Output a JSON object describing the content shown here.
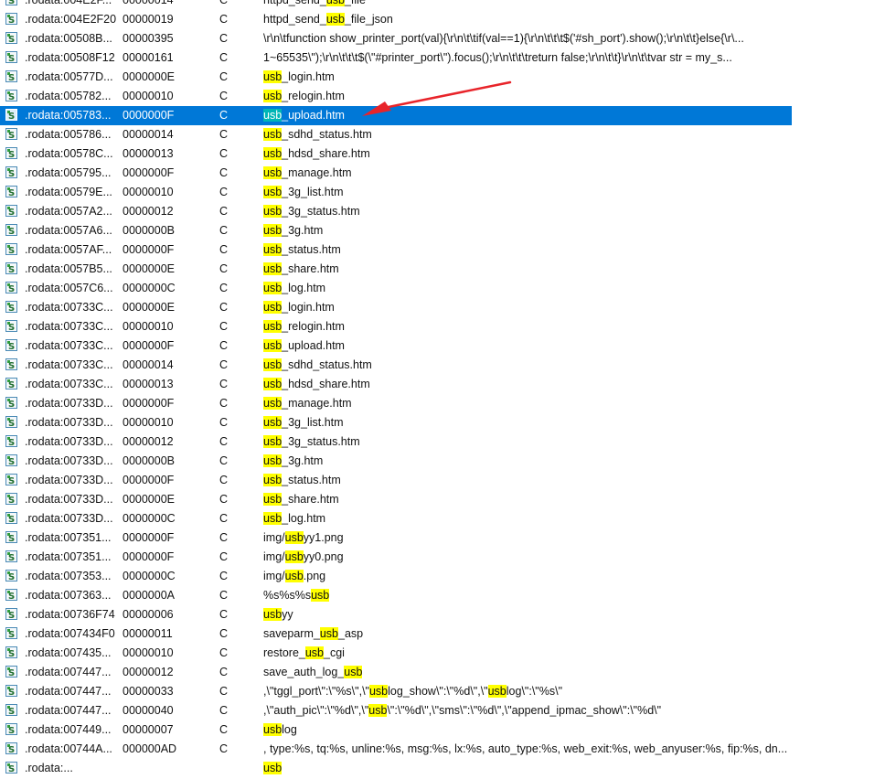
{
  "highlight_term": "usb",
  "colors": {
    "selection": "#0078d7",
    "highlight": "#ffff00",
    "arrow": "#e8242a"
  },
  "selected_index": 6,
  "rows": [
    {
      "address": ".rodata:004E2F...",
      "length": "00000014",
      "type": "C",
      "string": "httpd_send_usb_file"
    },
    {
      "address": ".rodata:004E2F20",
      "length": "00000019",
      "type": "C",
      "string": "httpd_send_usb_file_json"
    },
    {
      "address": ".rodata:00508B...",
      "length": "00000395",
      "type": "C",
      "string": "\\r\\n\\tfunction show_printer_port(val){\\r\\n\\t\\tif(val==1){\\r\\n\\t\\t\\t$('#sh_port').show();\\r\\n\\t\\t}else{\\r\\..."
    },
    {
      "address": ".rodata:00508F12",
      "length": "00000161",
      "type": "C",
      "string": "1~65535\\\");\\r\\n\\t\\t\\t$(\\\"#printer_port\\\").focus();\\r\\n\\t\\t\\treturn false;\\r\\n\\t\\t}\\r\\n\\t\\tvar str = my_s..."
    },
    {
      "address": ".rodata:00577D...",
      "length": "0000000E",
      "type": "C",
      "string": "usb_login.htm"
    },
    {
      "address": ".rodata:005782...",
      "length": "00000010",
      "type": "C",
      "string": "usb_relogin.htm"
    },
    {
      "address": ".rodata:005783...",
      "length": "0000000F",
      "type": "C",
      "string": "usb_upload.htm"
    },
    {
      "address": ".rodata:005786...",
      "length": "00000014",
      "type": "C",
      "string": "usb_sdhd_status.htm"
    },
    {
      "address": ".rodata:00578C...",
      "length": "00000013",
      "type": "C",
      "string": "usb_hdsd_share.htm"
    },
    {
      "address": ".rodata:005795...",
      "length": "0000000F",
      "type": "C",
      "string": "usb_manage.htm"
    },
    {
      "address": ".rodata:00579E...",
      "length": "00000010",
      "type": "C",
      "string": "usb_3g_list.htm"
    },
    {
      "address": ".rodata:0057A2...",
      "length": "00000012",
      "type": "C",
      "string": "usb_3g_status.htm"
    },
    {
      "address": ".rodata:0057A6...",
      "length": "0000000B",
      "type": "C",
      "string": "usb_3g.htm"
    },
    {
      "address": ".rodata:0057AF...",
      "length": "0000000F",
      "type": "C",
      "string": "usb_status.htm"
    },
    {
      "address": ".rodata:0057B5...",
      "length": "0000000E",
      "type": "C",
      "string": "usb_share.htm"
    },
    {
      "address": ".rodata:0057C6...",
      "length": "0000000C",
      "type": "C",
      "string": "usb_log.htm"
    },
    {
      "address": ".rodata:00733C...",
      "length": "0000000E",
      "type": "C",
      "string": "usb_login.htm"
    },
    {
      "address": ".rodata:00733C...",
      "length": "00000010",
      "type": "C",
      "string": "usb_relogin.htm"
    },
    {
      "address": ".rodata:00733C...",
      "length": "0000000F",
      "type": "C",
      "string": "usb_upload.htm"
    },
    {
      "address": ".rodata:00733C...",
      "length": "00000014",
      "type": "C",
      "string": "usb_sdhd_status.htm"
    },
    {
      "address": ".rodata:00733C...",
      "length": "00000013",
      "type": "C",
      "string": "usb_hdsd_share.htm"
    },
    {
      "address": ".rodata:00733D...",
      "length": "0000000F",
      "type": "C",
      "string": "usb_manage.htm"
    },
    {
      "address": ".rodata:00733D...",
      "length": "00000010",
      "type": "C",
      "string": "usb_3g_list.htm"
    },
    {
      "address": ".rodata:00733D...",
      "length": "00000012",
      "type": "C",
      "string": "usb_3g_status.htm"
    },
    {
      "address": ".rodata:00733D...",
      "length": "0000000B",
      "type": "C",
      "string": "usb_3g.htm"
    },
    {
      "address": ".rodata:00733D...",
      "length": "0000000F",
      "type": "C",
      "string": "usb_status.htm"
    },
    {
      "address": ".rodata:00733D...",
      "length": "0000000E",
      "type": "C",
      "string": "usb_share.htm"
    },
    {
      "address": ".rodata:00733D...",
      "length": "0000000C",
      "type": "C",
      "string": "usb_log.htm"
    },
    {
      "address": ".rodata:007351...",
      "length": "0000000F",
      "type": "C",
      "string": "img/usbyy1.png"
    },
    {
      "address": ".rodata:007351...",
      "length": "0000000F",
      "type": "C",
      "string": "img/usbyy0.png"
    },
    {
      "address": ".rodata:007353...",
      "length": "0000000C",
      "type": "C",
      "string": "img/usb.png"
    },
    {
      "address": ".rodata:007363...",
      "length": "0000000A",
      "type": "C",
      "string": "%s%s%susb"
    },
    {
      "address": ".rodata:00736F74",
      "length": "00000006",
      "type": "C",
      "string": "usbyy"
    },
    {
      "address": ".rodata:007434F0",
      "length": "00000011",
      "type": "C",
      "string": "saveparm_usb_asp"
    },
    {
      "address": ".rodata:007435...",
      "length": "00000010",
      "type": "C",
      "string": "restore_usb_cgi"
    },
    {
      "address": ".rodata:007447...",
      "length": "00000012",
      "type": "C",
      "string": "save_auth_log_usb"
    },
    {
      "address": ".rodata:007447...",
      "length": "00000033",
      "type": "C",
      "string": ",\\\"tggl_port\\\":\\\"%s\\\",\\\"usblog_show\\\":\\\"%d\\\",\\\"usblog\\\":\\\"%s\\\""
    },
    {
      "address": ".rodata:007447...",
      "length": "00000040",
      "type": "C",
      "string": ",\\\"auth_pic\\\":\\\"%d\\\",\\\"usb\\\":\\\"%d\\\",\\\"sms\\\":\\\"%d\\\",\\\"append_ipmac_show\\\":\\\"%d\\\""
    },
    {
      "address": ".rodata:007449...",
      "length": "00000007",
      "type": "C",
      "string": "usblog"
    },
    {
      "address": ".rodata:00744A...",
      "length": "000000AD",
      "type": "C",
      "string": ", type:%s, tq:%s, unline:%s, msg:%s, lx:%s, auto_type:%s, web_exit:%s, web_anyuser:%s, fip:%s, dn..."
    },
    {
      "address": ".rodata:...",
      "length": "",
      "type": "",
      "string": "usb"
    }
  ]
}
